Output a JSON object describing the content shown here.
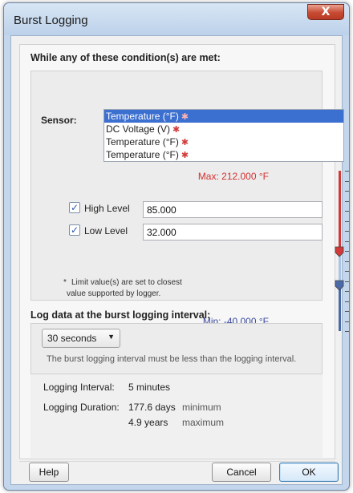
{
  "window": {
    "title": "Burst Logging",
    "close_glyph": "X"
  },
  "conditions": {
    "heading": "While any of these condition(s) are met:",
    "sensor_label": "Sensor:",
    "sensors": [
      {
        "label": "Temperature (°F)",
        "icon": "bug-icon",
        "selected": true
      },
      {
        "label": "DC Voltage (V)",
        "icon": "bug-icon",
        "selected": false
      },
      {
        "label": "Temperature (°F)",
        "icon": "bug-icon",
        "selected": false
      },
      {
        "label": "Temperature (°F)",
        "icon": "bug-icon",
        "selected": false
      }
    ],
    "max_label": "Max: 212.000 °F",
    "min_label": "Min: -40.000 °F",
    "high": {
      "label": "High Level",
      "value": "85.000",
      "checked": true
    },
    "low": {
      "label": "Low Level",
      "value": "32.000",
      "checked": true
    },
    "note_star": "*",
    "note_line1": "Limit value(s) are set to closest",
    "note_line2": "value supported by logger.",
    "slider": {
      "max": 212,
      "min": -40,
      "high": 85,
      "low": 32,
      "high_color": "#d23a3a",
      "low_color": "#4a6aa8"
    }
  },
  "interval": {
    "heading": "Log data at the burst logging interval:",
    "selected": "30 seconds",
    "helper": "The burst logging interval must be less than the logging interval."
  },
  "info": {
    "logging_interval_label": "Logging Interval:",
    "logging_interval_value": "5 minutes",
    "logging_duration_label": "Logging Duration:",
    "duration_min_value": "177.6 days",
    "duration_min_label": "minimum",
    "duration_max_value": "4.9 years",
    "duration_max_label": "maximum"
  },
  "buttons": {
    "help": "Help",
    "cancel": "Cancel",
    "ok": "OK"
  }
}
